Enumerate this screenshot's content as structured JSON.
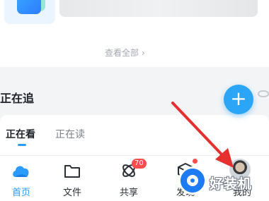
{
  "top_card": {
    "view_all_label": "查看全部",
    "view_all_chevron": "›"
  },
  "section": {
    "title": "正在追"
  },
  "tabs": [
    {
      "label": "正在看",
      "active": true
    },
    {
      "label": "正在读",
      "active": false
    }
  ],
  "fab": {
    "symbol": "+"
  },
  "bottom_nav": [
    {
      "label": "首页",
      "icon": "cloud-home-icon",
      "active": true
    },
    {
      "label": "文件",
      "icon": "folder-icon",
      "active": false
    },
    {
      "label": "共享",
      "icon": "share-atom-icon",
      "active": false,
      "badge": "70"
    },
    {
      "label": "发现",
      "icon": "cube-icon",
      "active": false,
      "dot": true
    },
    {
      "label": "我的",
      "icon": "avatar",
      "active": false
    }
  ],
  "watermark": {
    "text": "好装机"
  },
  "colors": {
    "accent": "#2b9bff",
    "fab": "#2aa5f7",
    "badge": "#ff4d4f",
    "annotation_arrow": "#e5302f"
  }
}
